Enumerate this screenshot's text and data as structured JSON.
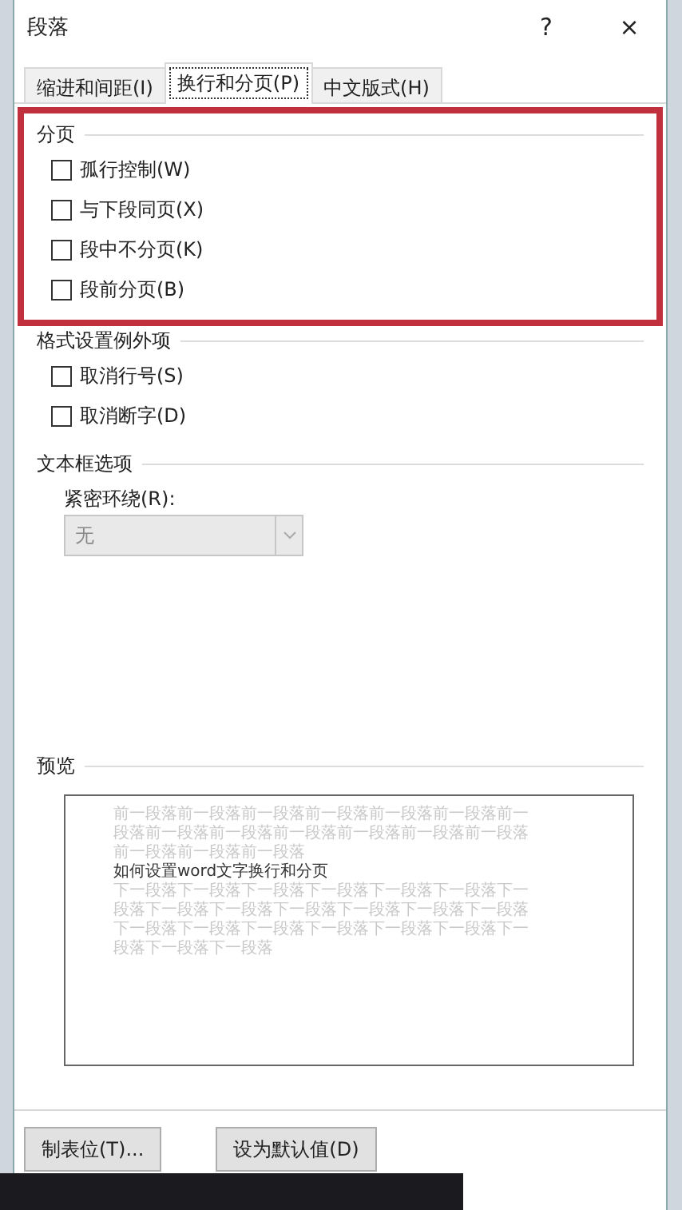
{
  "window": {
    "title": "段落",
    "help": "?",
    "close": "×"
  },
  "tabs": [
    {
      "label": "缩进和间距(I)",
      "selected": false
    },
    {
      "label": "换行和分页(P)",
      "selected": true
    },
    {
      "label": "中文版式(H)",
      "selected": false
    }
  ],
  "sections": [
    {
      "title": "分页",
      "highlighted": true,
      "options": [
        {
          "label": "孤行控制(W)",
          "checked": false
        },
        {
          "label": "与下段同页(X)",
          "checked": false
        },
        {
          "label": "段中不分页(K)",
          "checked": false
        },
        {
          "label": "段前分页(B)",
          "checked": false
        }
      ]
    },
    {
      "title": "格式设置例外项",
      "highlighted": false,
      "options": [
        {
          "label": "取消行号(S)",
          "checked": false
        },
        {
          "label": "取消断字(D)",
          "checked": false
        }
      ]
    }
  ],
  "textbox_options": {
    "title": "文本框选项",
    "label": "紧密环绕(R):",
    "value": "无",
    "disabled": true
  },
  "preview": {
    "title": "预览",
    "before": [
      "前一段落前一段落前一段落前一段落前一段落前一段落前一",
      "段落前一段落前一段落前一段落前一段落前一段落前一段落",
      "前一段落前一段落前一段落"
    ],
    "sample": "如何设置word文字换行和分页",
    "after": [
      "下一段落下一段落下一段落下一段落下一段落下一段落下一",
      "段落下一段落下一段落下一段落下一段落下一段落下一段落",
      "下一段落下一段落下一段落下一段落下一段落下一段落下一",
      "段落下一段落下一段落"
    ]
  },
  "buttons": [
    "制表位(T)...",
    "设为默认值(D)"
  ]
}
